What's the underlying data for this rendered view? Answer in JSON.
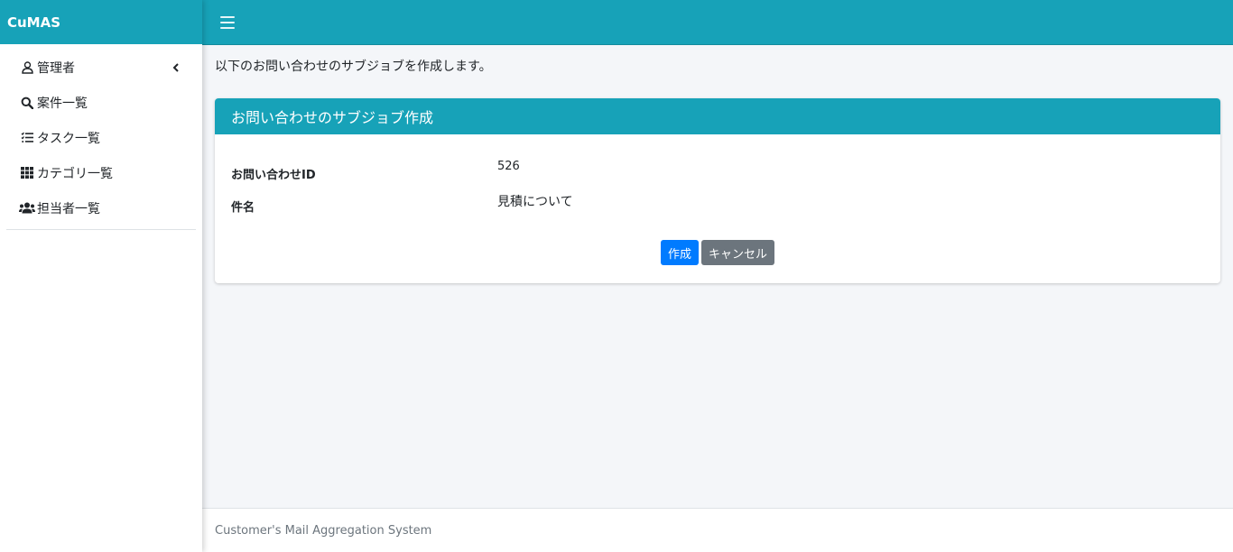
{
  "brand": {
    "name": "CuMAS"
  },
  "sidebar": {
    "items": [
      {
        "label": "管理者",
        "icon": "user-outline-icon",
        "has_chevron": true
      },
      {
        "label": "案件一覧",
        "icon": "search-icon"
      },
      {
        "label": "タスク一覧",
        "icon": "list-check-icon"
      },
      {
        "label": "カテゴリ一覧",
        "icon": "grid-icon"
      },
      {
        "label": "担当者一覧",
        "icon": "users-icon"
      }
    ]
  },
  "main": {
    "intro": "以下のお問い合わせのサブジョブを作成します。",
    "card": {
      "title": "お問い合わせのサブジョブ作成",
      "fields": [
        {
          "label": "お問い合わせID",
          "value": "526"
        },
        {
          "label": "件名",
          "value": "見積について"
        }
      ],
      "buttons": {
        "create": "作成",
        "cancel": "キャンセル"
      }
    }
  },
  "footer": {
    "text": "Customer's Mail Aggregation System"
  },
  "colors": {
    "accent": "#17a2b8",
    "primary": "#007bff",
    "secondary": "#6c757d",
    "background": "#f4f6f9"
  }
}
